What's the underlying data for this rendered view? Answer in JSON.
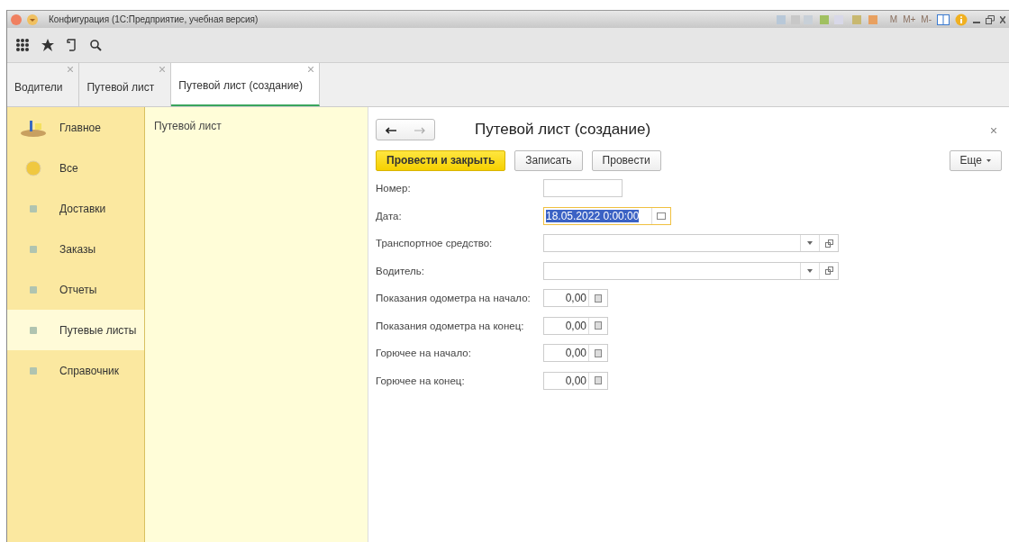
{
  "window": {
    "title": "Конфигурация  (1С:Предприятие, учебная версия)",
    "memory_buttons": [
      "M",
      "M+",
      "M-"
    ]
  },
  "tabs": [
    {
      "label": "Водители",
      "selected": false
    },
    {
      "label": "Путевой лист",
      "selected": false
    },
    {
      "label": "Путевой лист (создание)",
      "selected": true
    }
  ],
  "sidebar": {
    "items": [
      {
        "label": "Главное",
        "kind": "desk",
        "selected": false
      },
      {
        "label": "Все",
        "kind": "ball",
        "selected": false
      },
      {
        "label": "Доставки",
        "kind": "small",
        "selected": false
      },
      {
        "label": "Заказы",
        "kind": "small",
        "selected": false
      },
      {
        "label": "Отчеты",
        "kind": "small",
        "selected": false
      },
      {
        "label": "Путевые листы",
        "kind": "small",
        "selected": true
      },
      {
        "label": "Справочник",
        "kind": "small",
        "selected": false
      }
    ]
  },
  "nav_panel": {
    "items": [
      "Путевой лист"
    ]
  },
  "form": {
    "title": "Путевой лист (создание)",
    "buttons": [
      {
        "label": "Провести и закрыть",
        "primary": true
      },
      {
        "label": "Записать",
        "primary": false
      },
      {
        "label": "Провести",
        "primary": false
      }
    ],
    "more": "Еще",
    "fields": [
      {
        "label": "Номер:",
        "kind": "text"
      },
      {
        "label": "Дата:",
        "kind": "date",
        "value": "18.05.2022  0:00:00",
        "focused": true
      },
      {
        "label": "Транспортное средство:",
        "kind": "select"
      },
      {
        "label": "Водитель:",
        "kind": "select"
      },
      {
        "label": "Показания одометра на начало:",
        "kind": "number",
        "value": "0,00"
      },
      {
        "label": "Показания одометра на конец:",
        "kind": "number",
        "value": "0,00"
      },
      {
        "label": "Горючее на начало:",
        "kind": "number",
        "value": "0,00"
      },
      {
        "label": "Горючее на конец:",
        "kind": "number",
        "value": "0,00"
      }
    ]
  }
}
